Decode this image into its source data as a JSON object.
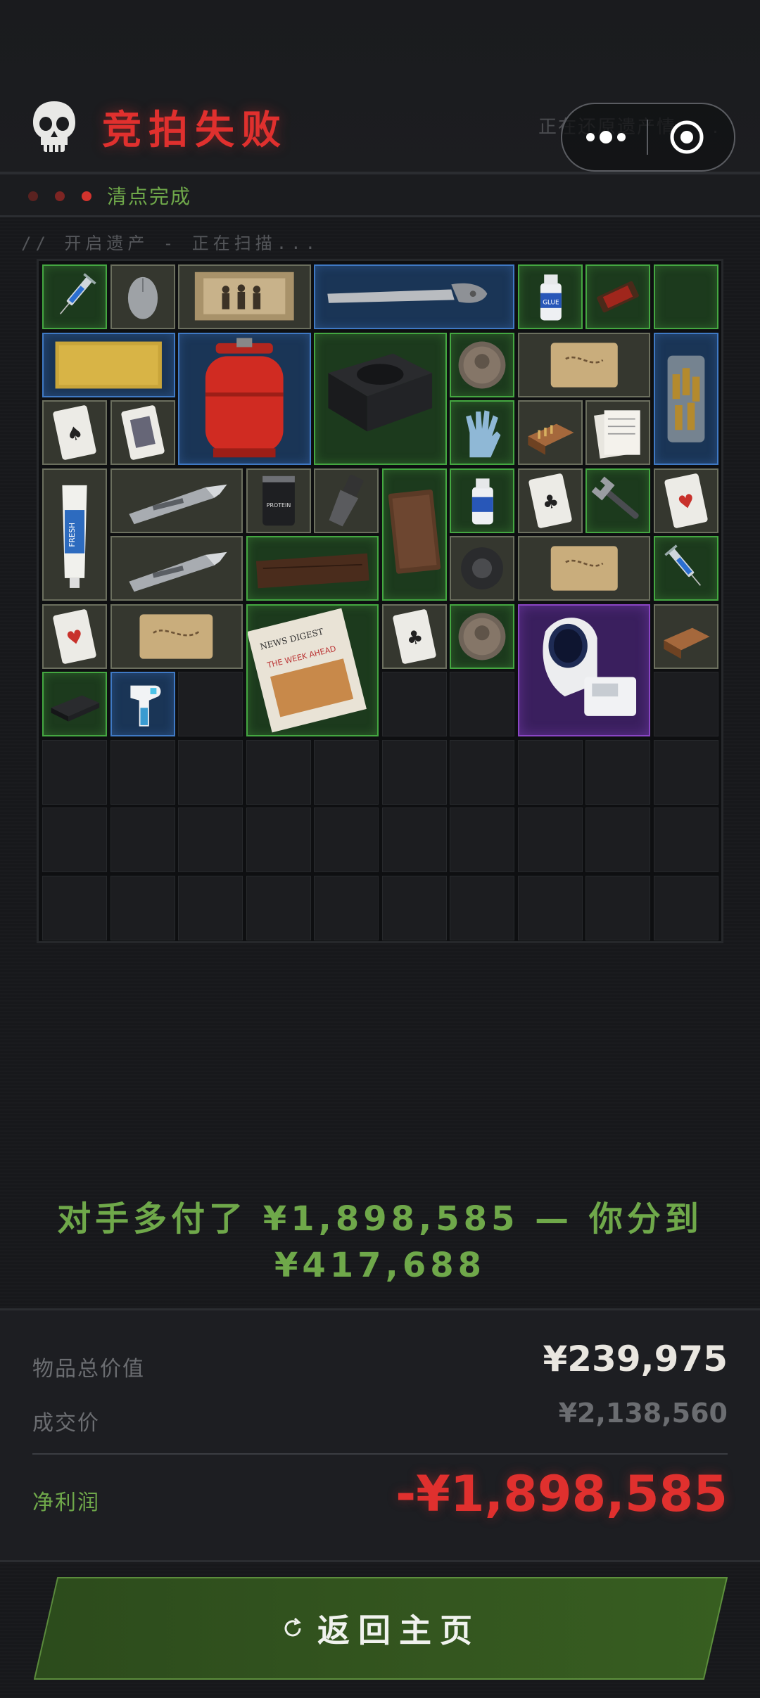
{
  "header": {
    "title": "竞拍失败",
    "status_faded": "正在还原遗产情 . . .",
    "skull_icon": "skull-icon",
    "more_icon": "more-dots-icon",
    "close_icon": "target-close-icon"
  },
  "progress": {
    "dots": [
      "#5a2220",
      "#7d2523",
      "#d2332d"
    ],
    "label": "清点完成"
  },
  "scan_text": "// 开启遗产 - 正在扫描...",
  "grid": {
    "columns": 10,
    "rows": 10,
    "items": [
      {
        "name": "syringe",
        "rarity": "green",
        "col": 0,
        "row": 0,
        "w": 1,
        "h": 1
      },
      {
        "name": "computer-mouse",
        "rarity": "common",
        "col": 1,
        "row": 0,
        "w": 1,
        "h": 1
      },
      {
        "name": "old-photo",
        "rarity": "common",
        "col": 2,
        "row": 0,
        "w": 2,
        "h": 1
      },
      {
        "name": "saw-blade",
        "rarity": "blue",
        "col": 4,
        "row": 0,
        "w": 3,
        "h": 1
      },
      {
        "name": "glue-bottle",
        "rarity": "green",
        "col": 7,
        "row": 0,
        "w": 1,
        "h": 1
      },
      {
        "name": "chocolate-bar",
        "rarity": "green",
        "col": 8,
        "row": 0,
        "w": 1,
        "h": 1
      },
      {
        "name": "chocolate-bar-2",
        "rarity": "green",
        "col": 9,
        "row": 0,
        "w": 1,
        "h": 1
      },
      {
        "name": "gold-bar",
        "rarity": "blue",
        "col": 0,
        "row": 1,
        "w": 2,
        "h": 1
      },
      {
        "name": "gas-cylinder",
        "rarity": "blue",
        "col": 2,
        "row": 1,
        "w": 2,
        "h": 2
      },
      {
        "name": "power-supply",
        "rarity": "green",
        "col": 4,
        "row": 1,
        "w": 2,
        "h": 2
      },
      {
        "name": "old-coin",
        "rarity": "green",
        "col": 6,
        "row": 1,
        "w": 1,
        "h": 1
      },
      {
        "name": "treasure-map",
        "rarity": "common",
        "col": 7,
        "row": 1,
        "w": 2,
        "h": 1
      },
      {
        "name": "ammo-jar",
        "rarity": "blue",
        "col": 9,
        "row": 1,
        "w": 1,
        "h": 2
      },
      {
        "name": "playing-card",
        "rarity": "common",
        "col": 0,
        "row": 2,
        "w": 1,
        "h": 1
      },
      {
        "name": "playing-card-face",
        "rarity": "common",
        "col": 1,
        "row": 2,
        "w": 1,
        "h": 1
      },
      {
        "name": "rubber-glove",
        "rarity": "green",
        "col": 6,
        "row": 2,
        "w": 1,
        "h": 1
      },
      {
        "name": "matchbox",
        "rarity": "common",
        "col": 7,
        "row": 2,
        "w": 1,
        "h": 1
      },
      {
        "name": "receipts",
        "rarity": "common",
        "col": 8,
        "row": 2,
        "w": 1,
        "h": 1
      },
      {
        "name": "toothpaste",
        "rarity": "common",
        "col": 0,
        "row": 3,
        "w": 1,
        "h": 2
      },
      {
        "name": "utility-knife",
        "rarity": "common",
        "col": 1,
        "row": 3,
        "w": 2,
        "h": 1
      },
      {
        "name": "protein-can",
        "rarity": "common",
        "col": 3,
        "row": 3,
        "w": 1,
        "h": 1
      },
      {
        "name": "pepper-grinder",
        "rarity": "common",
        "col": 4,
        "row": 3,
        "w": 1,
        "h": 1
      },
      {
        "name": "leather-journal",
        "rarity": "green",
        "col": 5,
        "row": 3,
        "w": 1,
        "h": 2
      },
      {
        "name": "glue-bottle-2",
        "rarity": "green",
        "col": 6,
        "row": 3,
        "w": 1,
        "h": 1
      },
      {
        "name": "playing-card-clubs",
        "rarity": "common",
        "col": 7,
        "row": 3,
        "w": 1,
        "h": 1
      },
      {
        "name": "wrench",
        "rarity": "green",
        "col": 8,
        "row": 3,
        "w": 1,
        "h": 1
      },
      {
        "name": "playing-card-hearts",
        "rarity": "common",
        "col": 9,
        "row": 3,
        "w": 1,
        "h": 1
      },
      {
        "name": "utility-knife-2",
        "rarity": "common",
        "col": 1,
        "row": 4,
        "w": 2,
        "h": 1
      },
      {
        "name": "wood-plank",
        "rarity": "green",
        "col": 3,
        "row": 4,
        "w": 2,
        "h": 1
      },
      {
        "name": "duct-tape",
        "rarity": "common",
        "col": 6,
        "row": 4,
        "w": 1,
        "h": 1
      },
      {
        "name": "treasure-map-2",
        "rarity": "common",
        "col": 7,
        "row": 4,
        "w": 2,
        "h": 1
      },
      {
        "name": "syringe-2",
        "rarity": "green",
        "col": 9,
        "row": 4,
        "w": 1,
        "h": 1
      },
      {
        "name": "playing-card-hearts-2",
        "rarity": "common",
        "col": 0,
        "row": 5,
        "w": 1,
        "h": 1
      },
      {
        "name": "treasure-map-3",
        "rarity": "common",
        "col": 1,
        "row": 5,
        "w": 2,
        "h": 1
      },
      {
        "name": "newspaper",
        "rarity": "green",
        "col": 3,
        "row": 5,
        "w": 2,
        "h": 2
      },
      {
        "name": "playing-card-clubs-2",
        "rarity": "common",
        "col": 5,
        "row": 5,
        "w": 1,
        "h": 1
      },
      {
        "name": "old-coin-2",
        "rarity": "green",
        "col": 6,
        "row": 5,
        "w": 1,
        "h": 1
      },
      {
        "name": "blood-pressure-monitor",
        "rarity": "purple",
        "col": 7,
        "row": 5,
        "w": 2,
        "h": 2
      },
      {
        "name": "matchbox-2",
        "rarity": "common",
        "col": 9,
        "row": 5,
        "w": 1,
        "h": 1
      },
      {
        "name": "external-drive",
        "rarity": "green",
        "col": 0,
        "row": 6,
        "w": 1,
        "h": 1
      },
      {
        "name": "thermometer-gun",
        "rarity": "blue",
        "col": 1,
        "row": 6,
        "w": 1,
        "h": 1
      }
    ],
    "newspaper_masthead": "NEWS DIGEST",
    "newspaper_headline": "THE WEEK AHEAD",
    "glue_label": "SUPER GLUE",
    "protein_label": "ULTRA PROTEIN",
    "toothpaste_label": "FRESH"
  },
  "summary": {
    "line1": "对手多付了 ¥1,898,585 — 你分到",
    "line2": "¥417,688"
  },
  "stats": {
    "total_value_label": "物品总价值",
    "total_value": "¥239,975",
    "deal_price_label": "成交价",
    "deal_price": "¥2,138,560",
    "net_profit_label": "净利润",
    "net_profit": "-¥1,898,585"
  },
  "home_button": {
    "label": "返回主页",
    "icon": "refresh-icon"
  },
  "colors": {
    "fail_red": "#e0302e",
    "accent_green": "#6fa84a",
    "rarity_green": "#44a741",
    "rarity_blue": "#3f79c4",
    "rarity_purple": "#8a45c4"
  }
}
